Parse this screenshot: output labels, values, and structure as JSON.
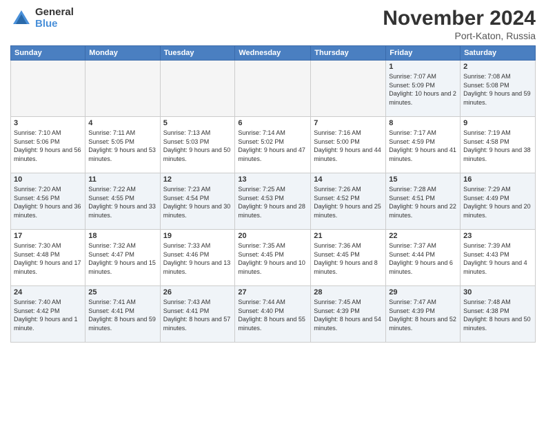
{
  "logo": {
    "general": "General",
    "blue": "Blue"
  },
  "header": {
    "title": "November 2024",
    "location": "Port-Katon, Russia"
  },
  "days_of_week": [
    "Sunday",
    "Monday",
    "Tuesday",
    "Wednesday",
    "Thursday",
    "Friday",
    "Saturday"
  ],
  "weeks": [
    [
      {
        "day": "",
        "info": ""
      },
      {
        "day": "",
        "info": ""
      },
      {
        "day": "",
        "info": ""
      },
      {
        "day": "",
        "info": ""
      },
      {
        "day": "",
        "info": ""
      },
      {
        "day": "1",
        "info": "Sunrise: 7:07 AM\nSunset: 5:09 PM\nDaylight: 10 hours and 2 minutes."
      },
      {
        "day": "2",
        "info": "Sunrise: 7:08 AM\nSunset: 5:08 PM\nDaylight: 9 hours and 59 minutes."
      }
    ],
    [
      {
        "day": "3",
        "info": "Sunrise: 7:10 AM\nSunset: 5:06 PM\nDaylight: 9 hours and 56 minutes."
      },
      {
        "day": "4",
        "info": "Sunrise: 7:11 AM\nSunset: 5:05 PM\nDaylight: 9 hours and 53 minutes."
      },
      {
        "day": "5",
        "info": "Sunrise: 7:13 AM\nSunset: 5:03 PM\nDaylight: 9 hours and 50 minutes."
      },
      {
        "day": "6",
        "info": "Sunrise: 7:14 AM\nSunset: 5:02 PM\nDaylight: 9 hours and 47 minutes."
      },
      {
        "day": "7",
        "info": "Sunrise: 7:16 AM\nSunset: 5:00 PM\nDaylight: 9 hours and 44 minutes."
      },
      {
        "day": "8",
        "info": "Sunrise: 7:17 AM\nSunset: 4:59 PM\nDaylight: 9 hours and 41 minutes."
      },
      {
        "day": "9",
        "info": "Sunrise: 7:19 AM\nSunset: 4:58 PM\nDaylight: 9 hours and 38 minutes."
      }
    ],
    [
      {
        "day": "10",
        "info": "Sunrise: 7:20 AM\nSunset: 4:56 PM\nDaylight: 9 hours and 36 minutes."
      },
      {
        "day": "11",
        "info": "Sunrise: 7:22 AM\nSunset: 4:55 PM\nDaylight: 9 hours and 33 minutes."
      },
      {
        "day": "12",
        "info": "Sunrise: 7:23 AM\nSunset: 4:54 PM\nDaylight: 9 hours and 30 minutes."
      },
      {
        "day": "13",
        "info": "Sunrise: 7:25 AM\nSunset: 4:53 PM\nDaylight: 9 hours and 28 minutes."
      },
      {
        "day": "14",
        "info": "Sunrise: 7:26 AM\nSunset: 4:52 PM\nDaylight: 9 hours and 25 minutes."
      },
      {
        "day": "15",
        "info": "Sunrise: 7:28 AM\nSunset: 4:51 PM\nDaylight: 9 hours and 22 minutes."
      },
      {
        "day": "16",
        "info": "Sunrise: 7:29 AM\nSunset: 4:49 PM\nDaylight: 9 hours and 20 minutes."
      }
    ],
    [
      {
        "day": "17",
        "info": "Sunrise: 7:30 AM\nSunset: 4:48 PM\nDaylight: 9 hours and 17 minutes."
      },
      {
        "day": "18",
        "info": "Sunrise: 7:32 AM\nSunset: 4:47 PM\nDaylight: 9 hours and 15 minutes."
      },
      {
        "day": "19",
        "info": "Sunrise: 7:33 AM\nSunset: 4:46 PM\nDaylight: 9 hours and 13 minutes."
      },
      {
        "day": "20",
        "info": "Sunrise: 7:35 AM\nSunset: 4:45 PM\nDaylight: 9 hours and 10 minutes."
      },
      {
        "day": "21",
        "info": "Sunrise: 7:36 AM\nSunset: 4:45 PM\nDaylight: 9 hours and 8 minutes."
      },
      {
        "day": "22",
        "info": "Sunrise: 7:37 AM\nSunset: 4:44 PM\nDaylight: 9 hours and 6 minutes."
      },
      {
        "day": "23",
        "info": "Sunrise: 7:39 AM\nSunset: 4:43 PM\nDaylight: 9 hours and 4 minutes."
      }
    ],
    [
      {
        "day": "24",
        "info": "Sunrise: 7:40 AM\nSunset: 4:42 PM\nDaylight: 9 hours and 1 minute."
      },
      {
        "day": "25",
        "info": "Sunrise: 7:41 AM\nSunset: 4:41 PM\nDaylight: 8 hours and 59 minutes."
      },
      {
        "day": "26",
        "info": "Sunrise: 7:43 AM\nSunset: 4:41 PM\nDaylight: 8 hours and 57 minutes."
      },
      {
        "day": "27",
        "info": "Sunrise: 7:44 AM\nSunset: 4:40 PM\nDaylight: 8 hours and 55 minutes."
      },
      {
        "day": "28",
        "info": "Sunrise: 7:45 AM\nSunset: 4:39 PM\nDaylight: 8 hours and 54 minutes."
      },
      {
        "day": "29",
        "info": "Sunrise: 7:47 AM\nSunset: 4:39 PM\nDaylight: 8 hours and 52 minutes."
      },
      {
        "day": "30",
        "info": "Sunrise: 7:48 AM\nSunset: 4:38 PM\nDaylight: 8 hours and 50 minutes."
      }
    ]
  ]
}
